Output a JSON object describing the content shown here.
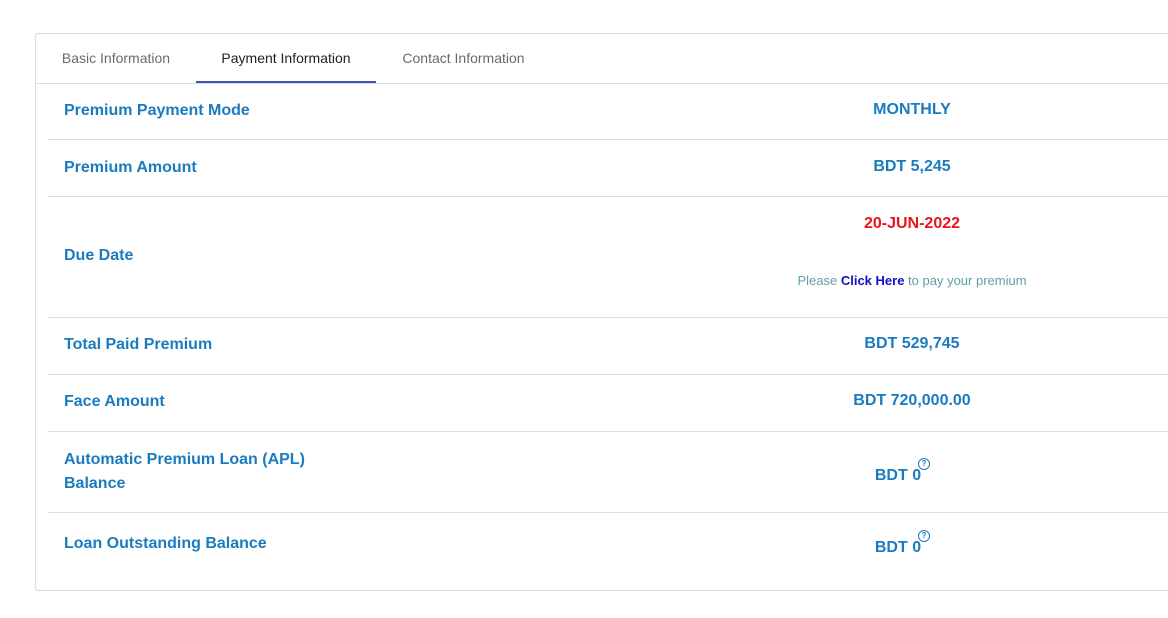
{
  "tabs": [
    {
      "label": "Basic Information",
      "active": false
    },
    {
      "label": "Payment Information",
      "active": true
    },
    {
      "label": "Contact Information",
      "active": false
    }
  ],
  "rows": {
    "payment_mode": {
      "label": "Premium Payment Mode",
      "value": "MONTHLY"
    },
    "premium_amount": {
      "label": "Premium Amount",
      "value": "BDT 5,245"
    },
    "due_date": {
      "label": "Due Date",
      "value": "20-JUN-2022",
      "note_prefix": "Please",
      "link_text": "Click Here",
      "note_suffix": "to pay your premium"
    },
    "total_paid": {
      "label": "Total Paid Premium",
      "value": "BDT 529,745"
    },
    "face_amount": {
      "label": "Face Amount",
      "value": "BDT 720,000.00"
    },
    "apl_balance": {
      "label_line1": "Automatic Premium Loan (APL)",
      "label_line2": "Balance",
      "value": "BDT 0",
      "help": "?"
    },
    "loan_balance": {
      "label": "Loan Outstanding Balance",
      "value": "BDT 0",
      "help": "?"
    }
  },
  "colors": {
    "label": "#1a7bbf",
    "due_date": "#e8141c",
    "link": "#1010c8",
    "tab_indicator": "#3f51b5"
  }
}
